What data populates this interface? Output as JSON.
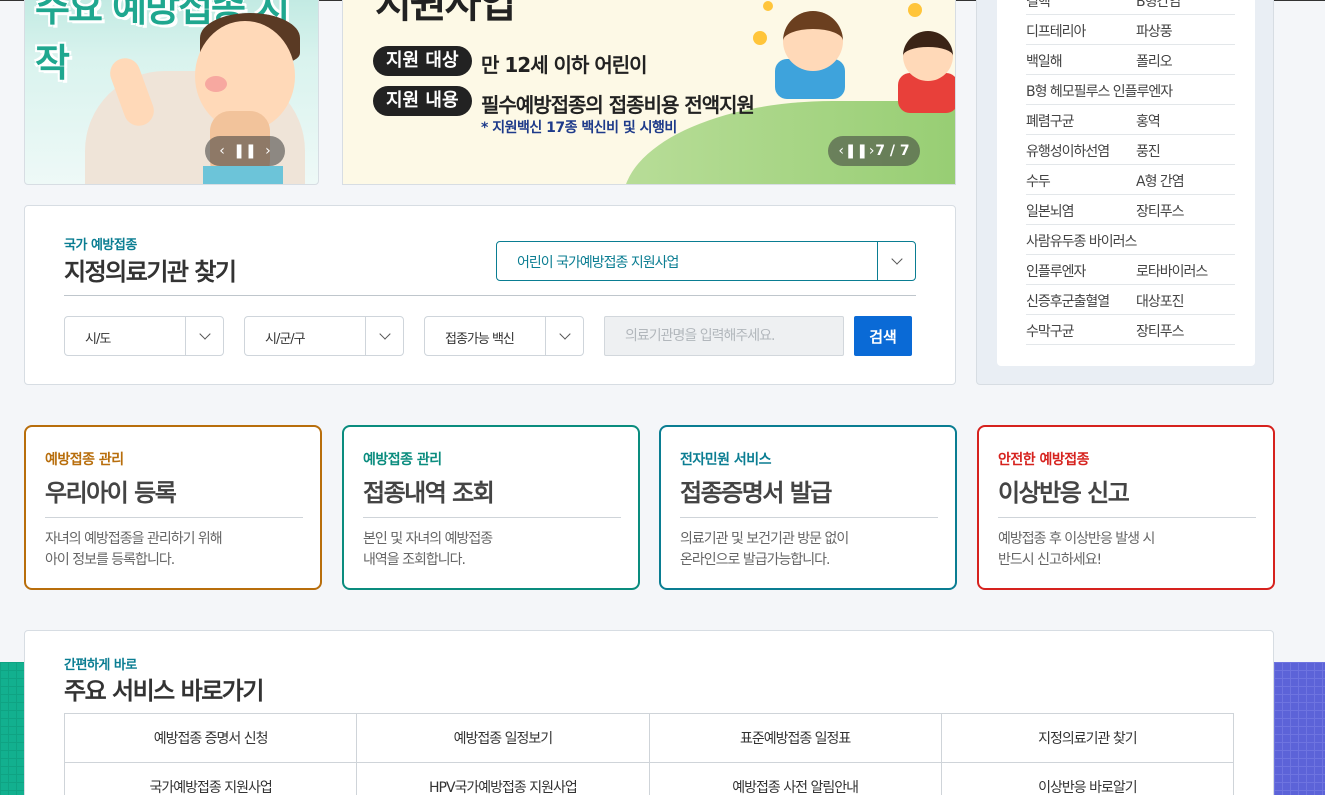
{
  "banner1": {
    "title": "주요 예방접종 시작"
  },
  "banner2": {
    "title": "지원사업",
    "target_pill": "지원 대상",
    "target_text": "만 12세 이하 어린이",
    "content_pill": "지원 내용",
    "content_text": "필수예방접종의 접종비용 전액지원",
    "note": "* 지원백신 17종 백신비 및 시행비",
    "counter": "7 / 7"
  },
  "search": {
    "subtitle": "국가 예방접종",
    "title": "지정의료기관 찾기",
    "program_select": "어린이 국가예방접종 지원사업",
    "sido_select": "시/도",
    "sigungu_select": "시/군/구",
    "vaccine_select": "접종가능 백신",
    "input_placeholder": "의료기관명을 입력해주세요.",
    "search_button": "검색"
  },
  "diseases": [
    [
      "결핵",
      "B형간염"
    ],
    [
      "디프테리아",
      "파상풍"
    ],
    [
      "백일해",
      "폴리오"
    ],
    [
      "B형 헤모필루스 인플루엔자",
      ""
    ],
    [
      "폐렴구균",
      "홍역"
    ],
    [
      "유행성이하선염",
      "풍진"
    ],
    [
      "수두",
      "A형 간염"
    ],
    [
      "일본뇌염",
      "장티푸스"
    ],
    [
      "사람유두종 바이러스",
      ""
    ],
    [
      "인플루엔자",
      "로타바이러스"
    ],
    [
      "신증후군출혈열",
      "대상포진"
    ],
    [
      "수막구균",
      "장티푸스"
    ]
  ],
  "cards": [
    {
      "subtitle": "예방접종 관리",
      "title": "우리아이 등록",
      "desc1": "자녀의 예방접종을 관리하기 위해",
      "desc2": "아이 정보를 등록합니다.",
      "color": "#b86e0c"
    },
    {
      "subtitle": "예방접종 관리",
      "title": "접종내역 조회",
      "desc1": "본인 및 자녀의 예방접종",
      "desc2": "내역을 조회합니다.",
      "color": "#0a8c7e"
    },
    {
      "subtitle": "전자민원 서비스",
      "title": "접종증명서 발급",
      "desc1": "의료기관 및 보건기관 방문 없이",
      "desc2": "온라인으로 발급가능합니다.",
      "color": "#0a7d92"
    },
    {
      "subtitle": "안전한 예방접종",
      "title": "이상반응 신고",
      "desc1": "예방접종 후 이상반응 발생 시",
      "desc2": "반드시 신고하세요!",
      "color": "#d6221e"
    }
  ],
  "quick": {
    "subtitle": "간편하게 바로",
    "title": "주요 서비스 바로가기",
    "links": [
      "예방접종 증명서 신청",
      "예방접종 일정보기",
      "표준예방접종 일정표",
      "지정의료기관 찾기",
      "국가예방접종 지원사업",
      "HPV국가예방접종 지원사업",
      "예방접종 사전 알림안내",
      "이상반응 바로알기"
    ]
  }
}
